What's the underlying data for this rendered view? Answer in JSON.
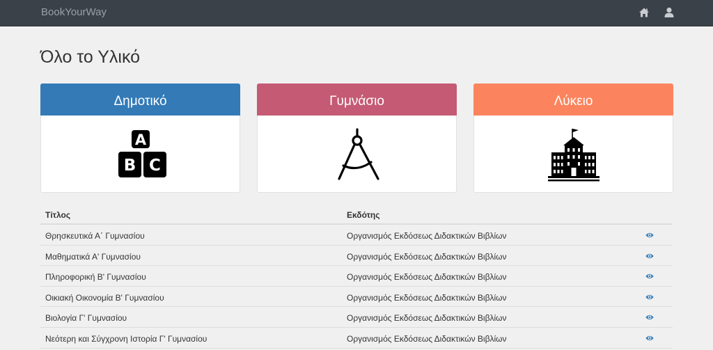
{
  "navbar": {
    "brand": "BookYourWay",
    "icons": [
      "home-icon",
      "user-icon"
    ]
  },
  "page": {
    "title": "Όλο το Υλικό"
  },
  "categories": [
    {
      "label": "Δημοτικό",
      "color": "#337ab7",
      "icon": "abc-blocks-icon"
    },
    {
      "label": "Γυμνάσιο",
      "color": "#c45a73",
      "icon": "drawing-compass-icon"
    },
    {
      "label": "Λύκειο",
      "color": "#fb845e",
      "icon": "school-building-icon"
    }
  ],
  "table": {
    "headers": [
      "Τίτλος",
      "Εκδότης"
    ],
    "rows": [
      {
        "title": "Θρησκευτικά Α΄ Γυμνασίου",
        "publisher": "Οργανισμός Εκδόσεως Διδακτικών Βιβλίων"
      },
      {
        "title": "Μαθηματικά Α' Γυμνασίου",
        "publisher": "Οργανισμός Εκδόσεως Διδακτικών Βιβλίων"
      },
      {
        "title": "Πληροφορική Β' Γυμνασίου",
        "publisher": "Οργανισμός Εκδόσεως Διδακτικών Βιβλίων"
      },
      {
        "title": "Οικιακή Οικονομία Β' Γυμνασίου",
        "publisher": "Οργανισμός Εκδόσεως Διδακτικών Βιβλίων"
      },
      {
        "title": "Βιολογία Γ' Γυμνασίου",
        "publisher": "Οργανισμός Εκδόσεως Διδακτικών Βιβλίων"
      },
      {
        "title": "Νεότερη και Σύγχρονη Ιστορία Γ' Γυμνασίου",
        "publisher": "Οργανισμός Εκδόσεως Διδακτικών Βιβλίων"
      }
    ],
    "row_icon": "eye-icon",
    "accent": "#337ab7"
  }
}
